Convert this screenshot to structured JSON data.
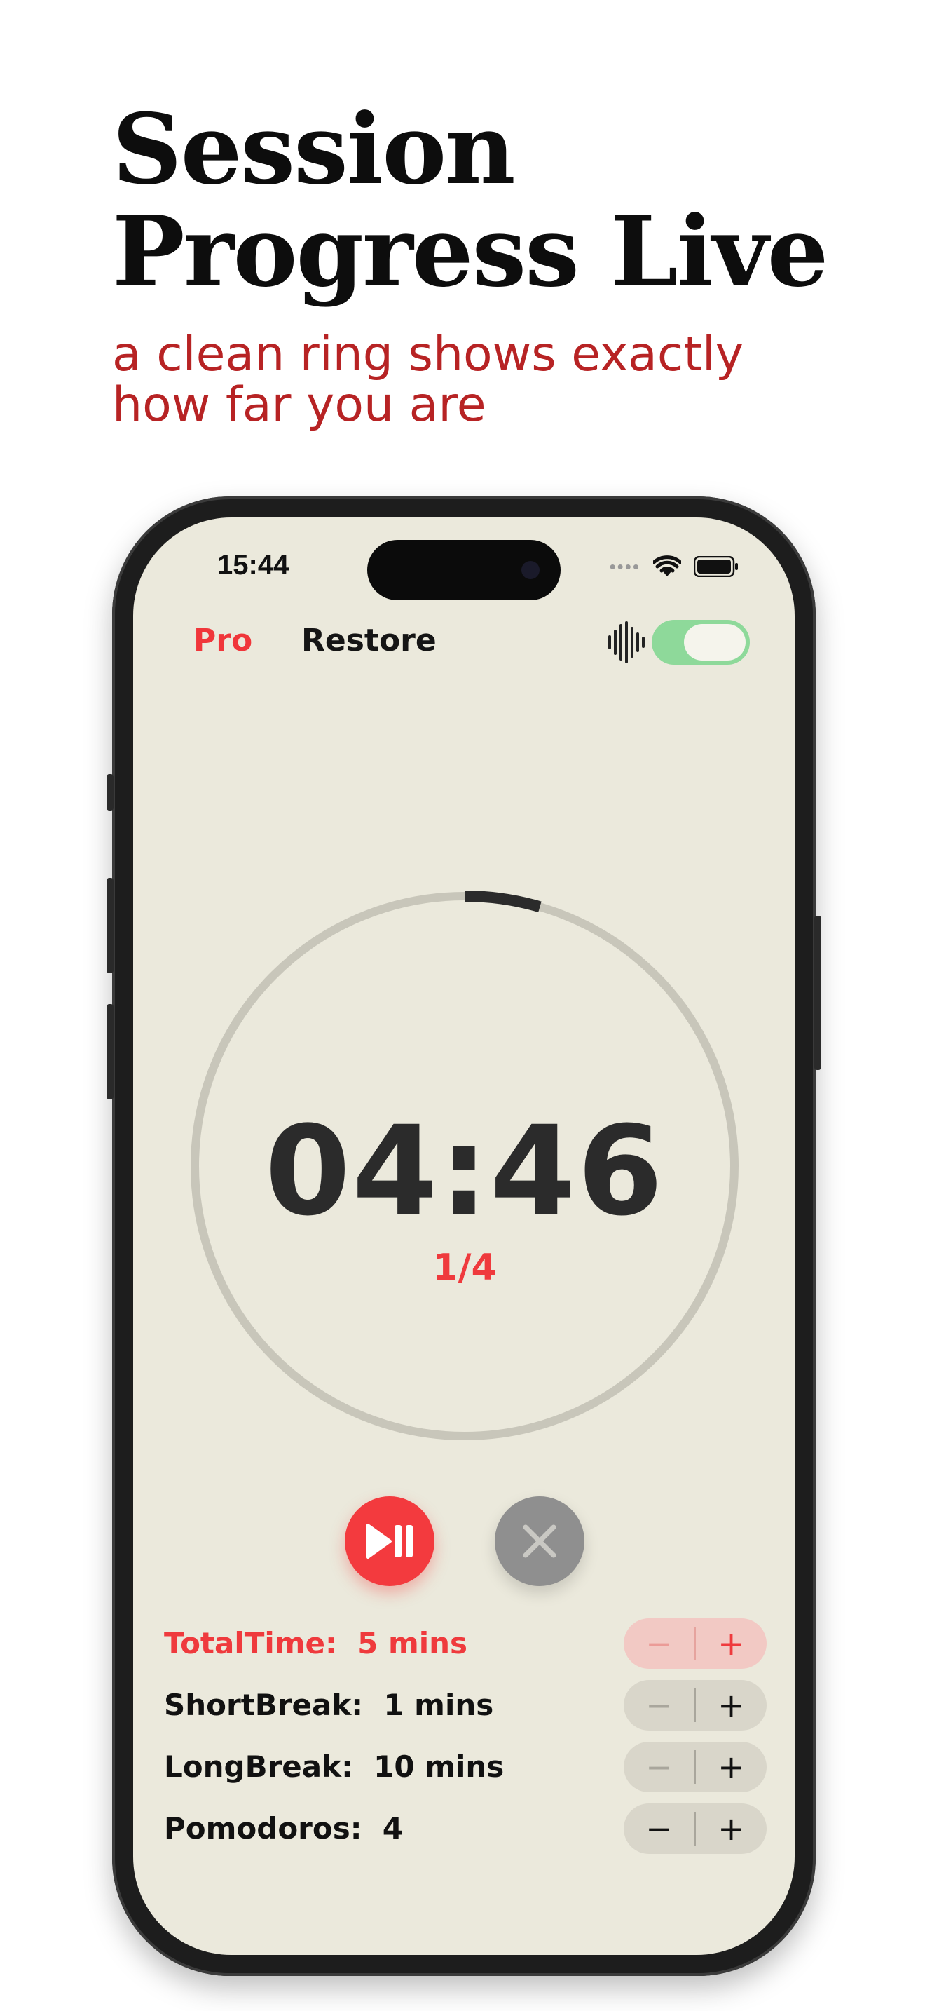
{
  "promo": {
    "headline_line1": "Session",
    "headline_line2": "Progress Live",
    "subline_line1": "a clean ring shows exactly",
    "subline_line2": "how far you are"
  },
  "status_bar": {
    "time": "15:44"
  },
  "header": {
    "pro_label": "Pro",
    "restore_label": "Restore",
    "sound_toggle_on": true
  },
  "timer": {
    "display": "04:46",
    "round": "1/4",
    "progress_fraction": 0.045
  },
  "settings": [
    {
      "label": "TotalTime:",
      "value": "5 mins",
      "minus": "−",
      "plus": "+"
    },
    {
      "label": "ShortBreak:",
      "value": "1 mins",
      "minus": "−",
      "plus": "+"
    },
    {
      "label": "LongBreak:",
      "value": "10 mins",
      "minus": "−",
      "plus": "+"
    },
    {
      "label": "Pomodoros:",
      "value": "4",
      "minus": "−",
      "plus": "+"
    }
  ],
  "colors": {
    "accent": "#ef3a3d",
    "background": "#ebe9dc",
    "ring_track": "#c8c6ba",
    "ring_progress": "#2b2b2b",
    "toggle_on": "#8ed99a"
  },
  "icons": {
    "play_pause": "play-pause-icon",
    "close": "close-icon",
    "sound": "sound-wave-icon",
    "wifi": "wifi-icon",
    "battery": "battery-icon"
  }
}
